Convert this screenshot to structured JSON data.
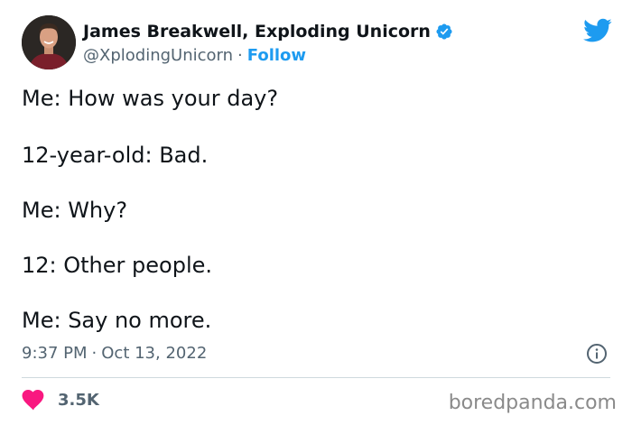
{
  "author": {
    "display_name": "James Breakwell, Exploding Unicorn",
    "handle": "@XplodingUnicorn",
    "separator": "·",
    "follow_label": "Follow",
    "verified": true
  },
  "tweet": {
    "lines": [
      "Me: How was your day?",
      "12-year-old: Bad.",
      "Me: Why?",
      "12: Other people.",
      "Me: Say no more."
    ],
    "time": "9:37 PM",
    "date": "Oct 13, 2022",
    "separator": "·"
  },
  "engagement": {
    "likes": "3.5K"
  },
  "watermark": "boredpanda.com",
  "colors": {
    "text": "#0f1419",
    "secondary": "#536471",
    "accent": "#1d9bf0",
    "heart": "#f91880",
    "divider": "#cfd9de"
  },
  "icons": {
    "verified": "verified-badge-icon",
    "brand": "twitter-bird-icon",
    "info": "info-icon",
    "like": "heart-icon"
  }
}
